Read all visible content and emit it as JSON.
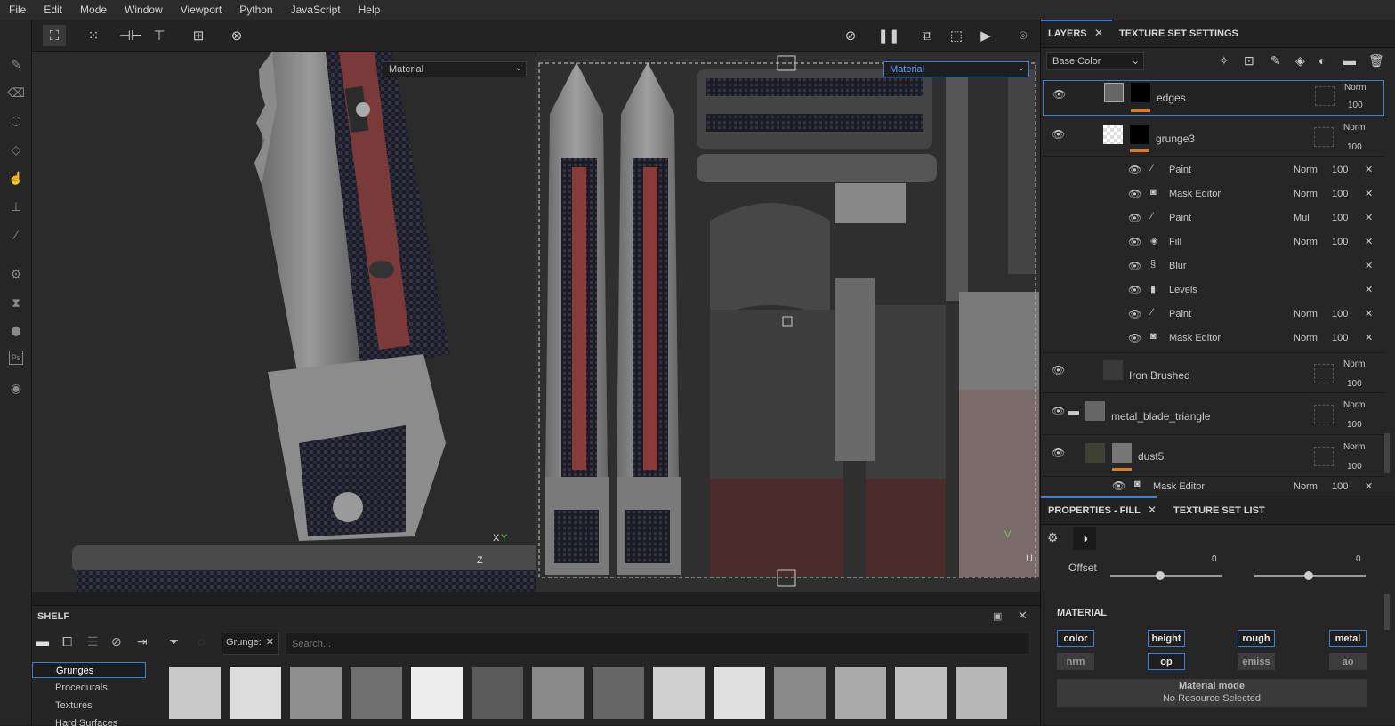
{
  "menu": [
    "File",
    "Edit",
    "Mode",
    "Window",
    "Viewport",
    "Python",
    "JavaScript",
    "Help"
  ],
  "left_tools": [
    "paint-brush-icon",
    "eraser-icon",
    "projection-icon",
    "polygon-fill-icon",
    "smudge-icon",
    "clone-stamp-icon",
    "color-picker-icon",
    "settings-gear-icon",
    "hourglass-icon",
    "cube-bake-icon",
    "photoshop-export-icon",
    "screenshot-icon"
  ],
  "viewport": {
    "left_material_select": "Material",
    "right_material_select": "Material",
    "axis_left": {
      "x": "X",
      "y": "Y",
      "z": "Z"
    },
    "axis_right": {
      "v": "V",
      "u": "U"
    }
  },
  "shelf": {
    "title": "SHELF",
    "filter_tag": "Grunge:",
    "search_placeholder": "Search...",
    "categories": [
      "Grunges",
      "Procedurals",
      "Textures",
      "Hard Surfaces"
    ],
    "selected_category": "Grunges"
  },
  "layers": {
    "tab_layers": "LAYERS",
    "tab_texture_set": "TEXTURE SET SETTINGS",
    "channel_select": "Base Color",
    "rows": [
      {
        "name": "edges",
        "blend": "Norm",
        "opacity": "100"
      },
      {
        "name": "grunge3",
        "blend": "Norm",
        "opacity": "100"
      },
      {
        "name": "Iron Brushed",
        "blend": "Norm",
        "opacity": "100"
      },
      {
        "name": "metal_blade_triangle",
        "blend": "Norm",
        "opacity": "100"
      },
      {
        "name": "dust5",
        "blend": "Norm",
        "opacity": "100"
      }
    ],
    "effects": [
      {
        "name": "Paint",
        "blend": "Norm",
        "opacity": "100"
      },
      {
        "name": "Mask Editor",
        "blend": "Norm",
        "opacity": "100"
      },
      {
        "name": "Paint",
        "blend": "Mul",
        "opacity": "100"
      },
      {
        "name": "Fill",
        "blend": "Norm",
        "opacity": "100"
      },
      {
        "name": "Blur",
        "blend": "",
        "opacity": ""
      },
      {
        "name": "Levels",
        "blend": "",
        "opacity": ""
      },
      {
        "name": "Paint",
        "blend": "Norm",
        "opacity": "100"
      },
      {
        "name": "Mask Editor",
        "blend": "Norm",
        "opacity": "100"
      }
    ],
    "dust_effect": {
      "name": "Mask Editor",
      "blend": "Norm",
      "opacity": "100"
    }
  },
  "properties": {
    "tab_props": "PROPERTIES - FILL",
    "tab_list": "TEXTURE SET LIST",
    "offset_label": "Offset",
    "offset_u": "0",
    "offset_v": "0",
    "offset_u_frac": 0.45,
    "offset_v_frac": 0.49,
    "material_label": "MATERIAL",
    "channels_row1": [
      "color",
      "height",
      "rough",
      "metal"
    ],
    "channels_row2": [
      "nrm",
      "op",
      "emiss",
      "ao"
    ],
    "material_mode_title": "Material mode",
    "material_mode_value": "No Resource Selected"
  },
  "colors": {
    "accent": "#3d7fd8",
    "orange": "#e07a1f",
    "bg": "#262626"
  }
}
